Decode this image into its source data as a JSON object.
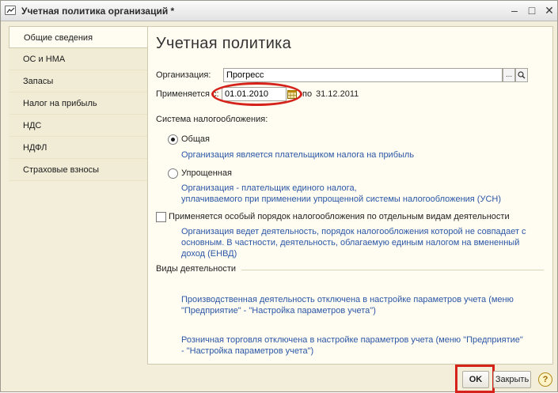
{
  "window": {
    "title": "Учетная политика организаций *",
    "minimize": "–",
    "maximize": "□",
    "close": "✕"
  },
  "nav": {
    "items": [
      {
        "label": "Общие сведения",
        "active": true
      },
      {
        "label": "ОС и НМА"
      },
      {
        "label": "Запасы"
      },
      {
        "label": "Налог на прибыль"
      },
      {
        "label": "НДС"
      },
      {
        "label": "НДФЛ"
      },
      {
        "label": "Страховые взносы"
      }
    ]
  },
  "form": {
    "title": "Учетная политика",
    "organization_label": "Организация:",
    "organization_value": "Прогресс",
    "organization_select_glyph": "...",
    "search_glyph": "🔍",
    "applies_label": "Применяется с:",
    "applies_from": "01.01.2010",
    "applies_to_label": "по",
    "applies_to": "31.12.2011",
    "tax_system_label": "Система налогообложения:",
    "general_label": "Общая",
    "general_note": "Организация является плательщиком налога на прибыль",
    "simplified_label": "Упрощенная",
    "simplified_note": [
      "Организация - плательщик единого налога,",
      "уплачиваемого при применении упрощенной системы налогообложения (УСН)"
    ],
    "special_order_label": "Применяется особый порядок налогообложения по отдельным видам деятельности",
    "special_order_note": [
      "Организация ведет деятельность, порядок налогообложения которой не совпадает с",
      "основным. В частности, деятельность, облагаемую единым налогом на вмененный",
      "доход (ЕНВД)"
    ],
    "activities_label": "Виды деятельности",
    "production_note": [
      "Производственная деятельность отключена в настройке параметров учета (меню",
      "\"Предприятие\" - \"Настройка параметров учета\")"
    ],
    "retail_note": [
      "Розничная торговля отключена в настройке параметров учета (меню \"Предприятие\"",
      "- \"Настройка параметров учета\")"
    ]
  },
  "footer": {
    "ok_label": "OK",
    "close_label": "Закрыть",
    "help_label": "?"
  },
  "colors": {
    "highlight": "#d5221b",
    "note_text": "#2b56a6",
    "panel_bg": "#fffdf1",
    "window_bg": "#f3eed9"
  }
}
